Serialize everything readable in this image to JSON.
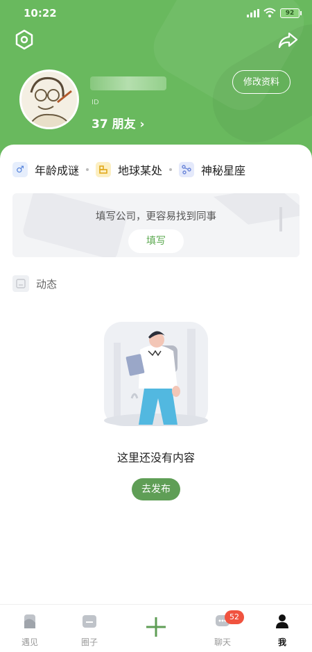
{
  "status": {
    "time": "10:22",
    "battery": "92"
  },
  "profile": {
    "friends_count": "37",
    "friends_label": "朋友",
    "id_text": "ID",
    "edit_label": "修改资料"
  },
  "tags": [
    {
      "label": "年龄成谜",
      "icon": "male-icon",
      "color": "#4a7bd8",
      "bg": "#e6eefc"
    },
    {
      "label": "地球某处",
      "icon": "location-icon",
      "color": "#e0a81a",
      "bg": "#fcefc2"
    },
    {
      "label": "神秘星座",
      "icon": "constellation-icon",
      "color": "#6a85d8",
      "bg": "#e4e9fb"
    }
  ],
  "company": {
    "prompt": "填写公司，更容易找到同事",
    "button": "填写"
  },
  "feed": {
    "title": "动态",
    "empty_text": "这里还没有内容",
    "post_button": "去发布"
  },
  "tabbar": {
    "items": [
      {
        "label": "遇见",
        "icon": "encounter-icon"
      },
      {
        "label": "圈子",
        "icon": "circle-icon"
      },
      {
        "label": "",
        "icon": "plus-icon"
      },
      {
        "label": "聊天",
        "icon": "chat-icon",
        "badge": "52"
      },
      {
        "label": "我",
        "icon": "me-icon"
      }
    ]
  },
  "colors": {
    "primary": "#69b95e",
    "button": "#5f9e56",
    "badge": "#f0533f"
  }
}
